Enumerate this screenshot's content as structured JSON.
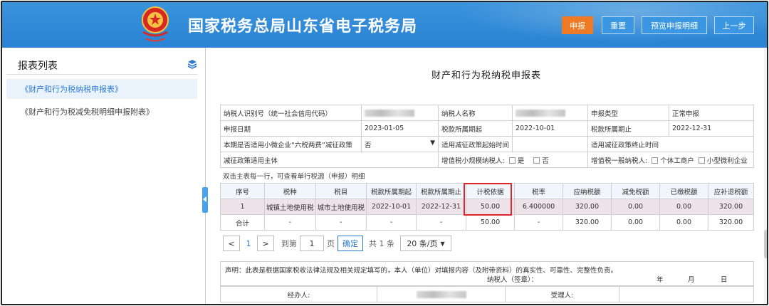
{
  "header": {
    "title": "国家税务总局山东省电子税务局",
    "buttons": [
      "申报",
      "重置",
      "预览申报明细",
      "上一步"
    ],
    "accent_color": "#ee7a25",
    "bar_color": "#3a93dc"
  },
  "sidebar": {
    "title": "报表列表",
    "items": [
      "《财产和行为税纳税申报表》",
      "《财产和行为税减免税明细申报附表》"
    ]
  },
  "form": {
    "title": "财产和行为税纳税申报表",
    "info": {
      "r1": [
        "纳税人识别号（统一社会信用代码）",
        "纳税人名称",
        "申报类型",
        "正常申报"
      ],
      "r2": [
        "申报日期",
        "2023-01-05",
        "税款所属期起",
        "2022-10-01",
        "税款所属期止",
        "2022-12-31"
      ],
      "r3": [
        "本期是否适用小微企业“六税两费”减征政策",
        "否",
        "适用减征政策起始时间",
        "适用减征政策终止时间"
      ],
      "r4": [
        "减征政策适用主体",
        "增值税小规模纳税人:",
        "是",
        "否",
        "增值税一般纳税人:",
        "个体工商户",
        "小型微利企业"
      ]
    },
    "note": "双击主表每一行，可查看单行税源（申报）明细",
    "columns": [
      "序号",
      "税种",
      "税目",
      "税款所属期起",
      "税款所属期止",
      "计税依据",
      "税率",
      "应纳税额",
      "减免税额",
      "已缴税额",
      "应补退税额"
    ],
    "rows": [
      [
        "1",
        "城镇土地使用税",
        "城市土地使用税",
        "2022-10-01",
        "2022-12-31",
        "50.00",
        "6.400000",
        "320.00",
        "0.00",
        "0.00",
        "320.00"
      ]
    ],
    "total": [
      "合计",
      "-",
      "-",
      "-",
      "-",
      "50.00",
      "-",
      "320.00",
      "0.00",
      "0.00",
      "320.00"
    ]
  },
  "pager": {
    "current": "1",
    "goto_label": "到第",
    "goto_value": "1",
    "page_label": "页",
    "confirm": "确定",
    "count": "共 1 条",
    "page_size": "20 条/页"
  },
  "declaration": {
    "text": "声明：此表是根据国家税收法律法规及相关规定填写的，本人（单位）对填报内容（及附带资料）的真实性、可靠性、完整性负责。",
    "signer": "纳税人（签章）：",
    "year": "年",
    "month": "月",
    "day": "日",
    "agent": "经办人:",
    "receiver": "受理人:"
  }
}
